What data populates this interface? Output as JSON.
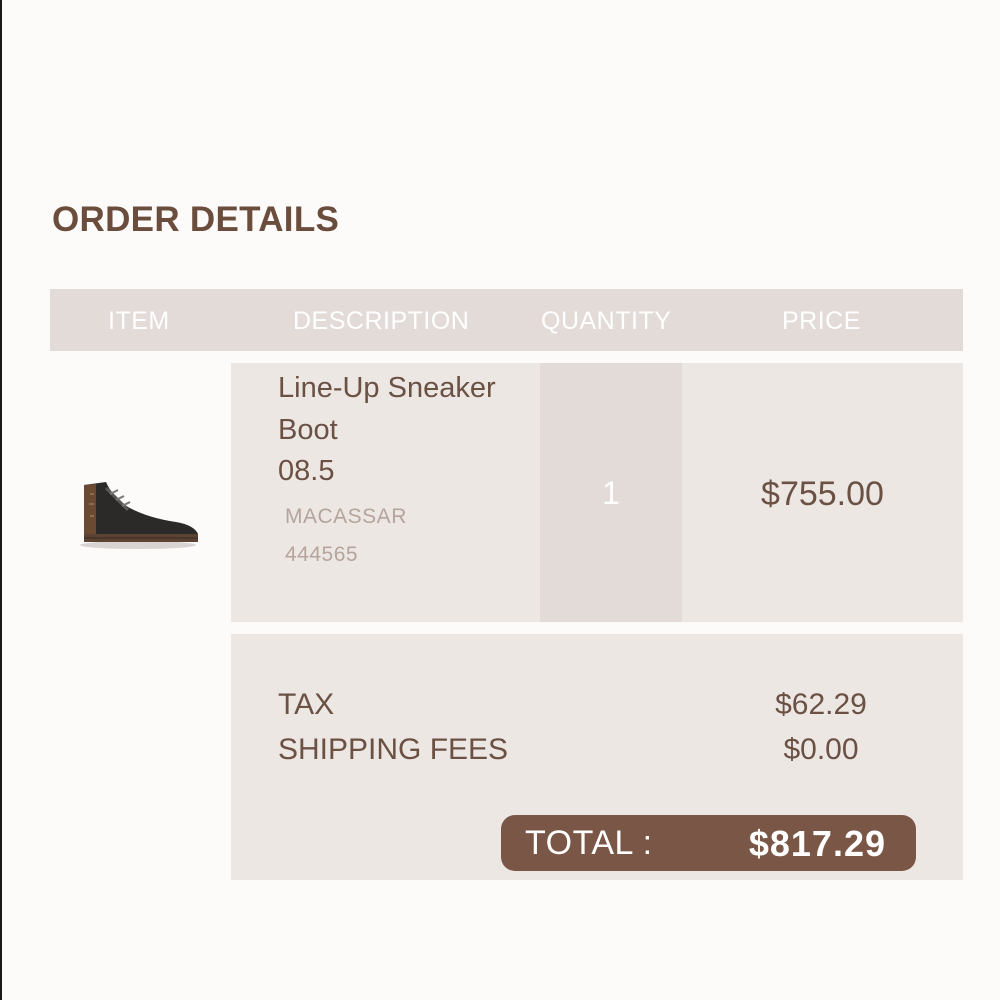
{
  "page": {
    "title": "ORDER DETAILS"
  },
  "table": {
    "headers": {
      "item": "ITEM",
      "description": "DESCRIPTION",
      "quantity": "QUANTITY",
      "price": "PRICE"
    },
    "row": {
      "image_icon": "sneaker-boot-image",
      "name": "Line-Up Sneaker Boot",
      "size": "08.5",
      "color": "MACASSAR",
      "sku": "444565",
      "quantity": "1",
      "price": "$755.00"
    }
  },
  "summary": {
    "tax_label": "TAX",
    "tax_value": "$62.29",
    "shipping_label": "SHIPPING FEES",
    "shipping_value": "$0.00",
    "total_label": "TOTAL :",
    "total_value": "$817.29"
  },
  "colors": {
    "accent": "#7a5647",
    "title": "#6b4d3d",
    "header_bg": "#e2dbd7",
    "row_bg": "#ede7e4"
  }
}
